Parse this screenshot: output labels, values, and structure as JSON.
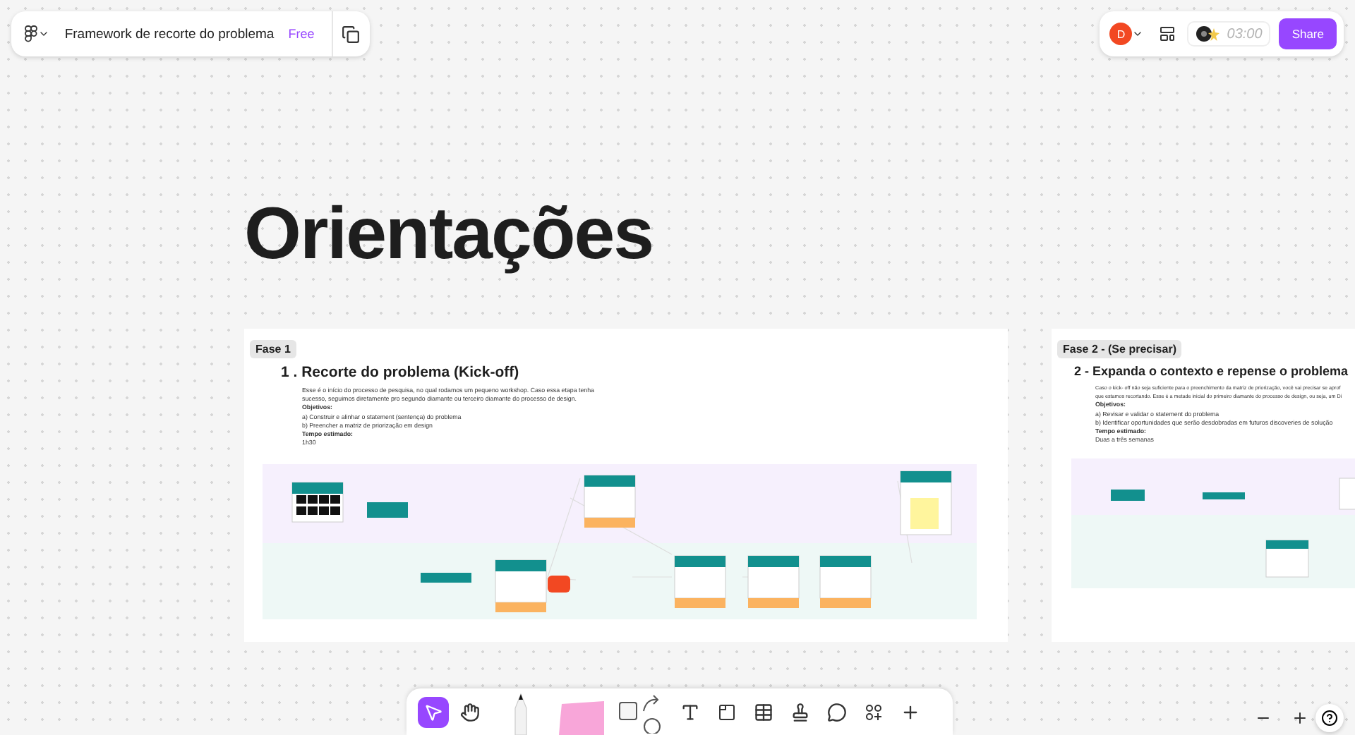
{
  "file_bar": {
    "title": "Framework de recorte do problema",
    "plan": "Free"
  },
  "share_bar": {
    "avatar": "D",
    "timer": "03:00",
    "share": "Share"
  },
  "board_title": "Orientações",
  "sections": [
    {
      "label": "Fase 1",
      "title": "1 . Recorte do problema (Kick-off)",
      "paragraph": [
        "Esse é o início do processo de pesquisa, no qual rodamos um pequeno workshop. Caso essa etapa tenha",
        "sucesso, seguimos diretamente pro segundo diamante ou terceiro diamante do processo de design."
      ],
      "objectives_heading": "Objetivos:",
      "objectives": [
        "a) Construir e alinhar o statement (sentença) do problema",
        "b) Preencher a matriz de priorização em design"
      ],
      "time_heading": "Tempo estimado:",
      "time": "1h30",
      "kind": "full"
    },
    {
      "label": "Fase 2 - (Se precisar)",
      "title": "2 - Expanda o contexto e repense o problema",
      "paragraph": [
        "Caso o kick- off não seja suficiente para o preenchimento da matriz de priorização, você vai precisar se aprof",
        "que estamos recortando. Esse é a metade inicial do primeiro diamante do processo de design, ou seja, um Di"
      ],
      "objectives_heading": "Objetivos:",
      "objectives": [
        "a) Revisar e validar o statement do problema",
        "b) Identificar oportunidades que serão desdobradas em futuros discoveries de solução"
      ],
      "time_heading": "Tempo estimado:",
      "time": "Duas a três semanas",
      "kind": "partial"
    }
  ],
  "tools": [
    {
      "kind": "select",
      "selected": true
    },
    {
      "kind": "hand",
      "selected": false
    },
    {
      "kind": "pen",
      "selected": false
    },
    {
      "kind": "sticky",
      "selected": false
    },
    {
      "kind": "shapes",
      "selected": false
    },
    {
      "kind": "text",
      "selected": false
    },
    {
      "kind": "section",
      "selected": false
    },
    {
      "kind": "table",
      "selected": false
    },
    {
      "kind": "stamp",
      "selected": false
    },
    {
      "kind": "comment",
      "selected": false
    },
    {
      "kind": "widgets",
      "selected": false
    },
    {
      "kind": "more",
      "selected": false
    }
  ]
}
